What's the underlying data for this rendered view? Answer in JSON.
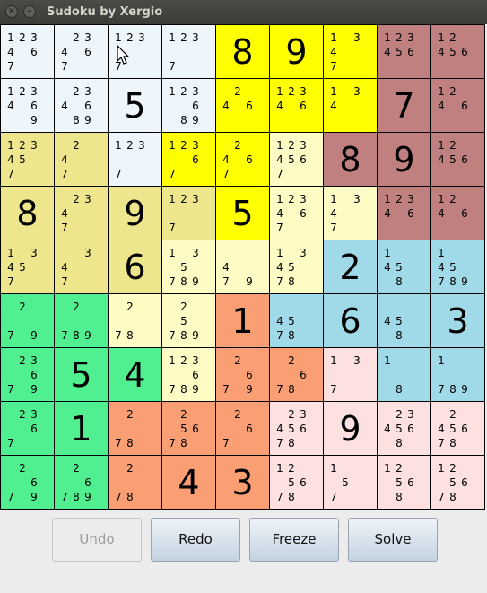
{
  "window": {
    "title": "Sudoku by Xergio"
  },
  "colors": {
    "A": "#eef6fc",
    "B": "#ffff00",
    "C": "#c08080",
    "D": "#ede68c",
    "E": "#fefcc4",
    "F": "#a0dae8",
    "G": "#50ef8f",
    "H": "#fa9f74",
    "I": "#fde0e0"
  },
  "board": {
    "rows": [
      [
        {
          "color": "A",
          "c": [
            "1",
            "2",
            "3",
            "4",
            "",
            "6",
            "7",
            "",
            ""
          ]
        },
        {
          "color": "A",
          "c": [
            "",
            "2",
            "3",
            "4",
            "",
            "6",
            "7",
            "",
            ""
          ]
        },
        {
          "color": "A",
          "c": [
            "1",
            "2",
            "3",
            "",
            "",
            "",
            "7",
            "",
            ""
          ]
        },
        {
          "color": "A",
          "c": [
            "1",
            "2",
            "3",
            "",
            "",
            "",
            "7",
            "",
            ""
          ]
        },
        {
          "color": "B",
          "v": "8"
        },
        {
          "color": "B",
          "v": "9"
        },
        {
          "color": "B",
          "c": [
            "1",
            "",
            "3",
            "4",
            "",
            "",
            "7",
            "",
            ""
          ]
        },
        {
          "color": "C",
          "c": [
            "1",
            "2",
            "3",
            "4",
            "5",
            "6",
            "",
            "",
            ""
          ]
        },
        {
          "color": "C",
          "c": [
            "1",
            "2",
            "",
            "4",
            "5",
            "6",
            "",
            "",
            ""
          ]
        }
      ],
      [
        {
          "color": "A",
          "c": [
            "1",
            "2",
            "3",
            "4",
            "",
            "6",
            "",
            "",
            "9"
          ]
        },
        {
          "color": "A",
          "c": [
            "",
            "2",
            "3",
            "4",
            "",
            "6",
            "",
            "8",
            "9"
          ]
        },
        {
          "color": "A",
          "v": "5"
        },
        {
          "color": "A",
          "c": [
            "1",
            "2",
            "3",
            "",
            "",
            "6",
            "",
            "8",
            "9"
          ]
        },
        {
          "color": "B",
          "c": [
            "",
            "2",
            "",
            "4",
            "",
            "6",
            "",
            "",
            ""
          ]
        },
        {
          "color": "B",
          "c": [
            "1",
            "2",
            "3",
            "4",
            "",
            "6",
            "",
            "",
            ""
          ]
        },
        {
          "color": "B",
          "c": [
            "1",
            "",
            "3",
            "4",
            "",
            "",
            "",
            "",
            ""
          ]
        },
        {
          "color": "C",
          "v": "7"
        },
        {
          "color": "C",
          "c": [
            "1",
            "2",
            "",
            "4",
            "",
            "6",
            "",
            "",
            ""
          ]
        }
      ],
      [
        {
          "color": "D",
          "c": [
            "1",
            "2",
            "3",
            "4",
            "5",
            "",
            "7",
            "",
            ""
          ]
        },
        {
          "color": "D",
          "c": [
            "",
            "2",
            "",
            "4",
            "",
            "",
            "7",
            "",
            ""
          ]
        },
        {
          "color": "A",
          "c": [
            "1",
            "2",
            "3",
            "",
            "",
            "",
            "7",
            "",
            ""
          ]
        },
        {
          "color": "B",
          "c": [
            "1",
            "2",
            "3",
            "",
            "",
            "6",
            "7",
            "",
            ""
          ]
        },
        {
          "color": "B",
          "c": [
            "",
            "2",
            "",
            "4",
            "",
            "6",
            "7",
            "",
            ""
          ]
        },
        {
          "color": "E",
          "c": [
            "1",
            "2",
            "3",
            "4",
            "5",
            "6",
            "7",
            "",
            ""
          ]
        },
        {
          "color": "C",
          "v": "8"
        },
        {
          "color": "C",
          "v": "9"
        },
        {
          "color": "C",
          "c": [
            "1",
            "2",
            "",
            "4",
            "5",
            "6",
            "",
            "",
            ""
          ]
        }
      ],
      [
        {
          "color": "D",
          "v": "8"
        },
        {
          "color": "D",
          "c": [
            "",
            "2",
            "3",
            "4",
            "",
            "",
            "7",
            "",
            ""
          ]
        },
        {
          "color": "D",
          "v": "9"
        },
        {
          "color": "D",
          "c": [
            "1",
            "2",
            "3",
            "",
            "",
            "",
            "7",
            "",
            ""
          ]
        },
        {
          "color": "B",
          "v": "5"
        },
        {
          "color": "E",
          "c": [
            "1",
            "2",
            "3",
            "4",
            "",
            "6",
            "7",
            "",
            ""
          ]
        },
        {
          "color": "E",
          "c": [
            "1",
            "",
            "3",
            "4",
            "",
            "",
            "7",
            "",
            ""
          ]
        },
        {
          "color": "C",
          "c": [
            "1",
            "2",
            "3",
            "4",
            "",
            "6",
            "",
            "",
            ""
          ]
        },
        {
          "color": "C",
          "c": [
            "1",
            "2",
            "",
            "4",
            "",
            "6",
            "",
            "",
            ""
          ]
        }
      ],
      [
        {
          "color": "D",
          "c": [
            "1",
            "",
            "3",
            "4",
            "5",
            "",
            "7",
            "",
            ""
          ]
        },
        {
          "color": "D",
          "c": [
            "",
            "",
            "3",
            "4",
            "",
            "",
            "7",
            "",
            ""
          ]
        },
        {
          "color": "D",
          "v": "6"
        },
        {
          "color": "E",
          "c": [
            "1",
            "",
            "3",
            "",
            "5",
            "",
            "7",
            "8",
            "9"
          ]
        },
        {
          "color": "E",
          "c": [
            "",
            "",
            "",
            "4",
            "",
            "",
            "7",
            "",
            "9"
          ]
        },
        {
          "color": "E",
          "c": [
            "1",
            "",
            "3",
            "4",
            "5",
            "",
            "7",
            "8",
            ""
          ]
        },
        {
          "color": "F",
          "v": "2"
        },
        {
          "color": "F",
          "c": [
            "1",
            "",
            "",
            "4",
            "5",
            "",
            "",
            "8",
            ""
          ]
        },
        {
          "color": "F",
          "c": [
            "1",
            "",
            "",
            "4",
            "5",
            "",
            "7",
            "8",
            "9"
          ]
        }
      ],
      [
        {
          "color": "G",
          "c": [
            "",
            "2",
            "",
            "",
            "",
            "",
            "7",
            "",
            "9"
          ]
        },
        {
          "color": "G",
          "c": [
            "",
            "2",
            "",
            "",
            "",
            "",
            "7",
            "8",
            "9"
          ]
        },
        {
          "color": "E",
          "c": [
            "",
            "2",
            "",
            "",
            "",
            "",
            "7",
            "8",
            ""
          ]
        },
        {
          "color": "E",
          "c": [
            "",
            "2",
            "",
            "",
            "5",
            "",
            "7",
            "8",
            "9"
          ]
        },
        {
          "color": "H",
          "v": "1"
        },
        {
          "color": "F",
          "c": [
            "",
            "",
            "",
            "4",
            "5",
            "",
            "7",
            "8",
            ""
          ]
        },
        {
          "color": "F",
          "v": "6"
        },
        {
          "color": "F",
          "c": [
            "",
            "",
            "",
            "4",
            "5",
            "",
            "",
            "8",
            ""
          ]
        },
        {
          "color": "F",
          "v": "3"
        }
      ],
      [
        {
          "color": "G",
          "c": [
            "",
            "2",
            "3",
            "",
            "",
            "6",
            "7",
            "",
            "9"
          ]
        },
        {
          "color": "G",
          "v": "5"
        },
        {
          "color": "G",
          "v": "4"
        },
        {
          "color": "E",
          "c": [
            "1",
            "2",
            "3",
            "",
            "",
            "6",
            "7",
            "8",
            "9"
          ]
        },
        {
          "color": "H",
          "c": [
            "",
            "2",
            "",
            "",
            "",
            "6",
            "7",
            "",
            "9"
          ]
        },
        {
          "color": "H",
          "c": [
            "",
            "2",
            "",
            "",
            "",
            "6",
            "7",
            "8",
            ""
          ]
        },
        {
          "color": "I",
          "c": [
            "1",
            "",
            "3",
            "",
            "",
            "",
            "7",
            "",
            ""
          ]
        },
        {
          "color": "F",
          "c": [
            "1",
            "",
            "",
            "",
            "",
            "",
            "",
            "8",
            ""
          ]
        },
        {
          "color": "F",
          "c": [
            "1",
            "",
            "",
            "",
            "",
            "",
            "7",
            "8",
            "9"
          ]
        }
      ],
      [
        {
          "color": "G",
          "c": [
            "",
            "2",
            "3",
            "",
            "",
            "6",
            "7",
            "",
            ""
          ]
        },
        {
          "color": "G",
          "v": "1"
        },
        {
          "color": "H",
          "c": [
            "",
            "2",
            "",
            "",
            "",
            "",
            "7",
            "8",
            ""
          ]
        },
        {
          "color": "H",
          "c": [
            "",
            "2",
            "",
            "",
            "5",
            "6",
            "7",
            "8",
            ""
          ]
        },
        {
          "color": "H",
          "c": [
            "",
            "2",
            "",
            "",
            "",
            "6",
            "7",
            "",
            ""
          ]
        },
        {
          "color": "I",
          "c": [
            "",
            "2",
            "3",
            "4",
            "5",
            "6",
            "7",
            "8",
            ""
          ]
        },
        {
          "color": "I",
          "v": "9"
        },
        {
          "color": "I",
          "c": [
            "",
            "2",
            "3",
            "4",
            "5",
            "6",
            "",
            "8",
            ""
          ]
        },
        {
          "color": "I",
          "c": [
            "",
            "2",
            "",
            "4",
            "5",
            "6",
            "7",
            "8",
            ""
          ]
        }
      ],
      [
        {
          "color": "G",
          "c": [
            "",
            "2",
            "",
            "",
            "",
            "6",
            "7",
            "",
            "9"
          ]
        },
        {
          "color": "G",
          "c": [
            "",
            "2",
            "",
            "",
            "",
            "6",
            "7",
            "8",
            "9"
          ]
        },
        {
          "color": "H",
          "c": [
            "",
            "2",
            "",
            "",
            "",
            "",
            "7",
            "8",
            ""
          ]
        },
        {
          "color": "H",
          "v": "4"
        },
        {
          "color": "H",
          "v": "3"
        },
        {
          "color": "I",
          "c": [
            "1",
            "2",
            "",
            "",
            "5",
            "6",
            "7",
            "8",
            ""
          ]
        },
        {
          "color": "I",
          "c": [
            "1",
            "",
            "",
            "",
            "5",
            "",
            "7",
            "",
            ""
          ]
        },
        {
          "color": "I",
          "c": [
            "1",
            "2",
            "",
            "",
            "5",
            "6",
            "",
            "8",
            ""
          ]
        },
        {
          "color": "I",
          "c": [
            "1",
            "2",
            "",
            "",
            "5",
            "6",
            "7",
            "8",
            ""
          ]
        }
      ]
    ]
  },
  "buttons": {
    "undo": "Undo",
    "redo": "Redo",
    "freeze": "Freeze",
    "solve": "Solve"
  }
}
